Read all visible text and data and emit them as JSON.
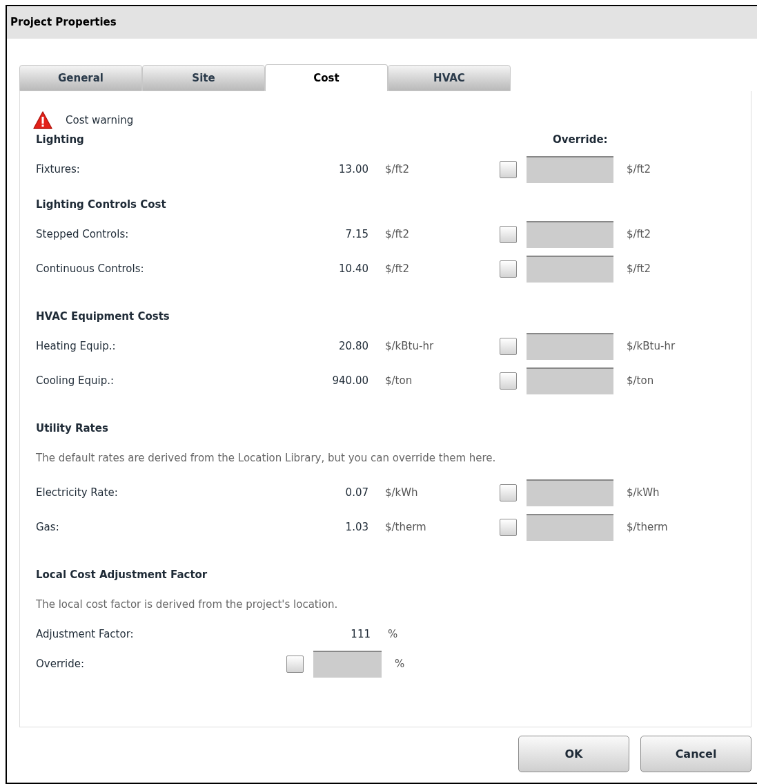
{
  "window": {
    "title": "Project Properties"
  },
  "tabs": [
    {
      "label": "General",
      "selected": false
    },
    {
      "label": "Site",
      "selected": false
    },
    {
      "label": "Cost",
      "selected": true
    },
    {
      "label": "HVAC",
      "selected": false
    }
  ],
  "warning": "Cost warning",
  "sections": [
    {
      "heading": "Lighting",
      "override_header": "Override:",
      "rows": [
        {
          "kind": "cost",
          "label": "Fixtures:",
          "value": "13.00",
          "unit": "$/ft2",
          "checked": false,
          "field_disabled": true,
          "override_unit": "$/ft2"
        }
      ]
    },
    {
      "heading": "Lighting Controls Cost",
      "rows": [
        {
          "kind": "cost",
          "label": "Stepped Controls:",
          "value": "7.15",
          "unit": "$/ft2",
          "checked": false,
          "field_disabled": true,
          "override_unit": "$/ft2"
        },
        {
          "kind": "cost",
          "label": "Continuous Controls:",
          "value": "10.40",
          "unit": "$/ft2",
          "checked": false,
          "field_disabled": true,
          "override_unit": "$/ft2"
        }
      ]
    },
    {
      "heading": "HVAC Equipment Costs",
      "rows": [
        {
          "kind": "cost",
          "label": "Heating Equip.:",
          "value": "20.80",
          "unit": "$/kBtu-hr",
          "checked": false,
          "field_disabled": true,
          "override_unit": "$/kBtu-hr"
        },
        {
          "kind": "cost",
          "label": "Cooling Equip.:",
          "value": "940.00",
          "unit": "$/ton",
          "checked": false,
          "field_disabled": true,
          "override_unit": "$/ton"
        }
      ]
    },
    {
      "heading": "Utility Rates",
      "note": "The default rates are derived from the Location Library, but you can override them here.",
      "rows": [
        {
          "kind": "cost",
          "label": "Electricity Rate:",
          "value": "0.07",
          "unit": "$/kWh",
          "checked": false,
          "field_disabled": true,
          "override_unit": "$/kWh"
        },
        {
          "kind": "cost",
          "label": "Gas:",
          "value": "1.03",
          "unit": "$/therm",
          "checked": false,
          "field_disabled": true,
          "override_unit": "$/therm"
        }
      ]
    },
    {
      "heading": "Local Cost Adjustment Factor",
      "note": "The local cost factor is derived from the project's location.",
      "rows": [
        {
          "kind": "value",
          "label": "Adjustment Factor:",
          "value": "111",
          "unit": "%"
        },
        {
          "kind": "override",
          "label": "Override:",
          "checked": false,
          "field_disabled": true,
          "override_unit": "%"
        }
      ]
    }
  ],
  "buttons": [
    "OK",
    "Cancel"
  ]
}
